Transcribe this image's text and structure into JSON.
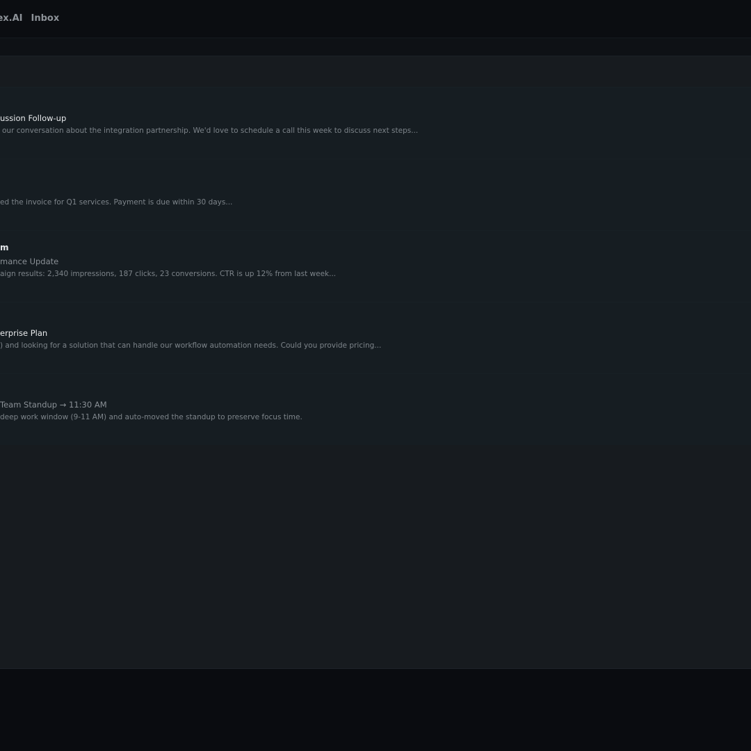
{
  "topbar": {
    "app_name": "lex.AI",
    "inbox_label": "Inbox"
  },
  "messages": [
    {
      "sender": "",
      "subject": "ussion Follow-up",
      "preview": "our conversation about the integration partnership. We'd love to schedule a call this week to discuss next steps..."
    },
    {
      "sender": "",
      "subject": "",
      "preview": "ed the invoice for Q1 services. Payment is due within 30 days..."
    },
    {
      "sender": "m",
      "subject": "mance Update",
      "preview": "aign results: 2,340 impressions, 187 clicks, 23 conversions. CTR is up 12% from last week..."
    },
    {
      "sender": "",
      "subject": "erprise Plan",
      "preview": ") and looking for a solution that can handle our workflow automation needs. Could you provide pricing..."
    },
    {
      "sender": "",
      "subject": "Team Standup → 11:30 AM",
      "preview": "deep work window (9-11 AM) and auto-moved the standup to preserve focus time."
    }
  ]
}
